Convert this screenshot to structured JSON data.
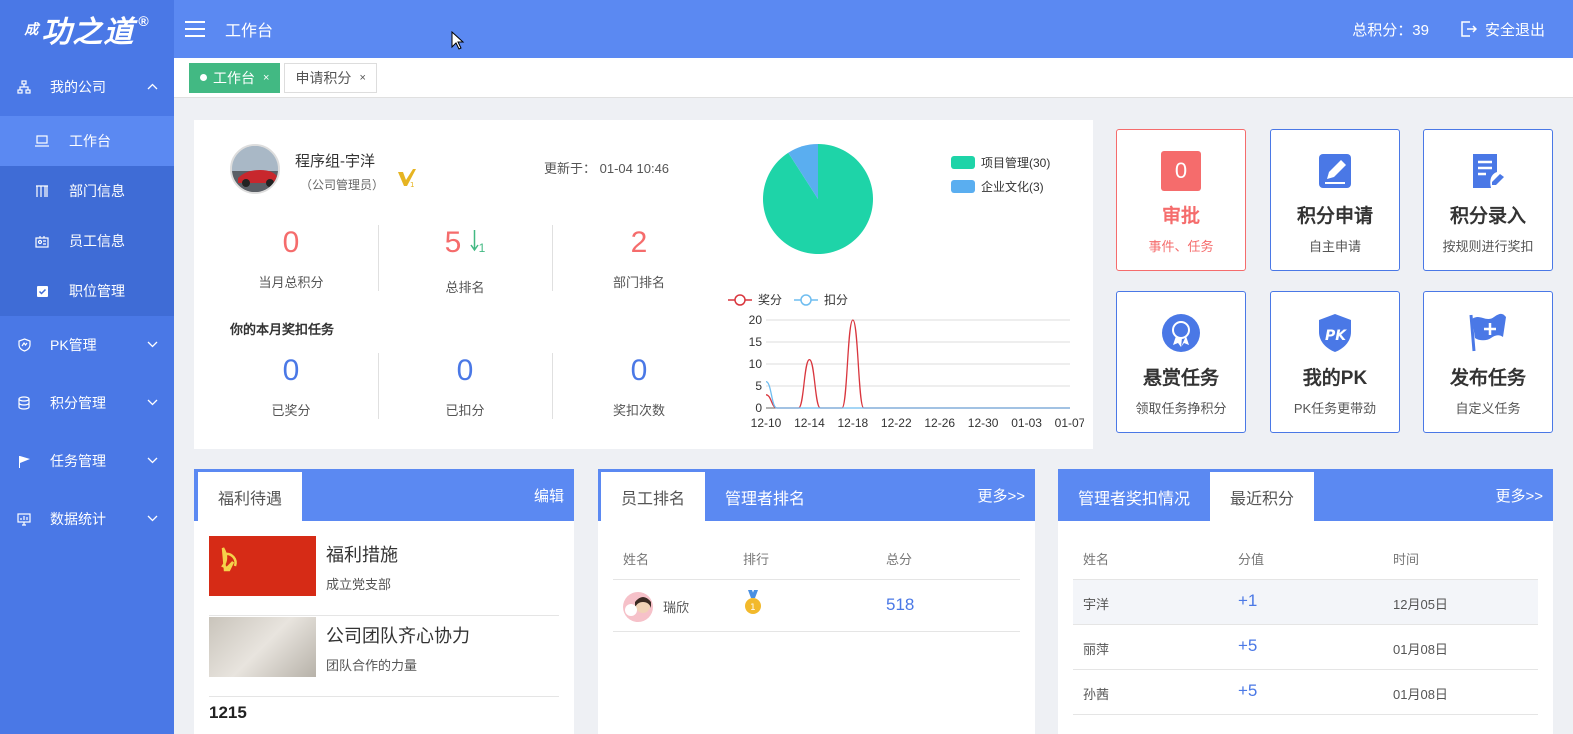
{
  "brand": {
    "logo_text": "功之道",
    "logo_prefix": "成",
    "registered": "®"
  },
  "sidebar": {
    "groups": [
      {
        "label": "我的公司",
        "icon": "org-chart-icon",
        "expanded": true,
        "items": [
          {
            "label": "工作台",
            "icon": "laptop-icon",
            "active": true
          },
          {
            "label": "部门信息",
            "icon": "building-icon",
            "active": false
          },
          {
            "label": "员工信息",
            "icon": "id-card-icon",
            "active": false
          },
          {
            "label": "职位管理",
            "icon": "clipboard-check-icon",
            "active": false
          }
        ]
      },
      {
        "label": "PK管理",
        "icon": "shield-icon",
        "expanded": false
      },
      {
        "label": "积分管理",
        "icon": "database-icon",
        "expanded": false
      },
      {
        "label": "任务管理",
        "icon": "flag-icon",
        "expanded": false
      },
      {
        "label": "数据统计",
        "icon": "monitor-chart-icon",
        "expanded": false
      }
    ]
  },
  "header": {
    "title": "工作台",
    "total_score": "总积分：39",
    "logout": "安全退出"
  },
  "tabs": [
    {
      "label": "工作台",
      "active": true,
      "close": "×"
    },
    {
      "label": "申请积分",
      "active": false,
      "close": "×"
    }
  ],
  "profile": {
    "name": "程序组-宇洋",
    "role": "（公司管理员）",
    "updated_label": "更新于：",
    "updated_time": "01-04 10:46",
    "stats": [
      {
        "value": "0",
        "label": "当月总积分"
      },
      {
        "value": "5",
        "label": "总排名",
        "delta": "1"
      },
      {
        "value": "2",
        "label": "部门排名"
      }
    ],
    "task_title": "你的本月奖扣任务",
    "task_stats": [
      {
        "value": "0",
        "label": "已奖分"
      },
      {
        "value": "0",
        "label": "已扣分"
      },
      {
        "value": "0",
        "label": "奖扣次数"
      }
    ]
  },
  "chart_data": [
    {
      "type": "pie",
      "series": [
        {
          "name": "项目管理(30)",
          "value": 30,
          "color": "#1ed4a8"
        },
        {
          "name": "企业文化(3)",
          "value": 3,
          "color": "#5aaef0"
        }
      ]
    },
    {
      "type": "line",
      "x": [
        "12-10",
        "12-11",
        "12-12",
        "12-13",
        "12-14",
        "12-15",
        "12-16",
        "12-17",
        "12-18",
        "12-19",
        "12-20",
        "12-21",
        "12-22",
        "12-23",
        "12-24",
        "12-25",
        "12-26",
        "12-27",
        "12-28",
        "12-29",
        "12-30",
        "12-31",
        "01-01",
        "01-02",
        "01-03",
        "01-04",
        "01-05",
        "01-06",
        "01-07"
      ],
      "tick_labels": [
        "12-10",
        "12-14",
        "12-18",
        "12-22",
        "12-26",
        "12-30",
        "01-03",
        "01-07"
      ],
      "ylim": [
        0,
        20
      ],
      "yticks": [
        0,
        5,
        10,
        15,
        20
      ],
      "series": [
        {
          "name": "奖分",
          "color": "#d9363e",
          "values": [
            3,
            0,
            0,
            0,
            11,
            0,
            0,
            0,
            20,
            0,
            0,
            0,
            0,
            0,
            0,
            0,
            0,
            0,
            0,
            0,
            0,
            0,
            0,
            0,
            0,
            0,
            0,
            0,
            0
          ]
        },
        {
          "name": "扣分",
          "color": "#6fbdf0",
          "values": [
            6,
            0,
            0,
            0,
            0,
            0,
            0,
            0,
            0,
            0,
            0,
            0,
            0,
            0,
            0,
            0,
            0,
            0,
            0,
            0,
            0,
            0,
            0,
            0,
            0,
            0,
            0,
            0,
            0
          ]
        }
      ]
    }
  ],
  "quick": [
    {
      "title": "审批",
      "sub": "事件、任务",
      "badge": "0",
      "icon": "badge-count"
    },
    {
      "title": "积分申请",
      "sub": "自主申请",
      "icon": "edit-doc-icon"
    },
    {
      "title": "积分录入",
      "sub": "按规则进行奖扣",
      "icon": "doc-entry-icon"
    },
    {
      "title": "悬赏任务",
      "sub": "领取任务挣积分",
      "icon": "medal-icon"
    },
    {
      "title": "我的PK",
      "sub": "PK任务更带劲",
      "icon": "pk-shield-icon"
    },
    {
      "title": "发布任务",
      "sub": "自定义任务",
      "icon": "flag-plus-icon"
    }
  ],
  "welfare": {
    "tab": "福利待遇",
    "edit": "编辑",
    "items": [
      {
        "title": "福利措施",
        "sub": "成立党支部"
      },
      {
        "title": "公司团队齐心协力",
        "sub": "团队合作的力量"
      }
    ],
    "third_title": "1215"
  },
  "ranking": {
    "tabs": [
      "员工排名",
      "管理者排名"
    ],
    "more": "更多>>",
    "columns": [
      "姓名",
      "排行",
      "总分"
    ],
    "rows": [
      {
        "name": "瑞欣",
        "score": "518"
      }
    ]
  },
  "recent": {
    "tabs": [
      "管理者奖扣情况",
      "最近积分"
    ],
    "more": "更多>>",
    "columns": [
      "姓名",
      "分值",
      "时间"
    ],
    "rows": [
      {
        "name": "宇洋",
        "value": "+1",
        "time": "12月05日"
      },
      {
        "name": "丽萍",
        "value": "+5",
        "time": "01月08日"
      },
      {
        "name": "孙茜",
        "value": "+5",
        "time": "01月08日"
      }
    ]
  },
  "colors": {
    "sidebar": "#4a78e6",
    "topbar": "#5b89f2",
    "accent_green": "#42b983",
    "danger": "#f56c6c"
  }
}
